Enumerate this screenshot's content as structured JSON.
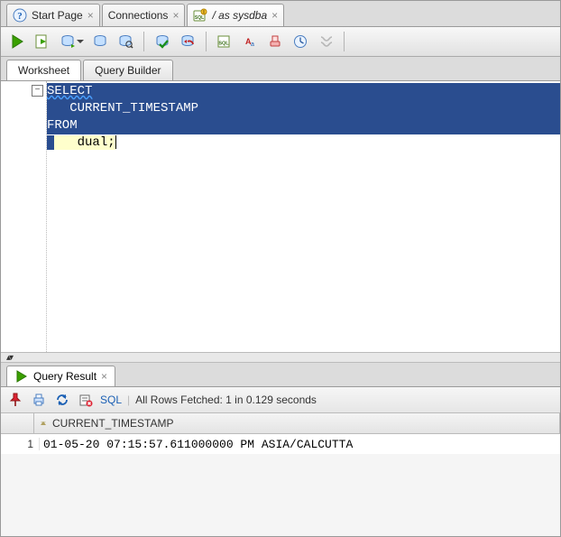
{
  "top_tabs": [
    {
      "label": "Start Page",
      "icon": "help-icon"
    },
    {
      "label": "Connections",
      "icon": null
    },
    {
      "label": "/ as sysdba",
      "icon": "sql-file-icon",
      "italic": true,
      "active": true
    }
  ],
  "worksheet_tabs": {
    "worksheet": "Worksheet",
    "query_builder": "Query Builder"
  },
  "code": {
    "l1": "SELECT",
    "l2": "   CURRENT_TIMESTAMP",
    "l3": "FROM",
    "l4": "   dual;"
  },
  "result_tab": {
    "label": "Query Result"
  },
  "result_toolbar": {
    "sql": "SQL",
    "status": "All Rows Fetched: 1 in 0.129 seconds"
  },
  "result_grid": {
    "column": "CURRENT_TIMESTAMP",
    "row_index": "1",
    "value": "01-05-20 07:15:57.611000000 PM ASIA/CALCUTTA"
  }
}
